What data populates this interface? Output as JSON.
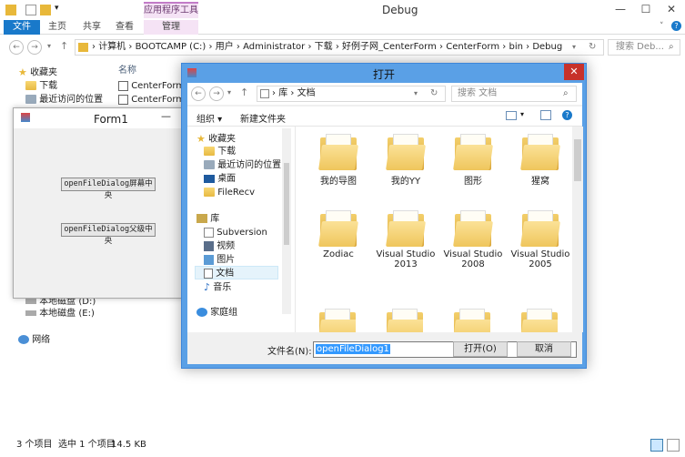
{
  "explorer": {
    "title": "Debug",
    "context_tool_label": "应用程序工具",
    "tabs": [
      "文件",
      "主页",
      "共享",
      "查看",
      "管理"
    ],
    "breadcrumb": [
      "计算机",
      "BOOTCAMP (C:)",
      "用户",
      "Administrator",
      "下载",
      "好例子网_CenterForm",
      "CenterForm",
      "bin",
      "Debug"
    ],
    "search_placeholder": "搜索 Deb...",
    "nav": {
      "favorites": "收藏夹",
      "downloads": "下载",
      "recent": "最近访问的位置",
      "local_disk_d": "本地磁盘 (D:)",
      "local_disk_e": "本地磁盘 (E:)",
      "network": "网络"
    },
    "column_name": "名称",
    "files": [
      "CenterForm.e",
      "CenterForm.p"
    ],
    "status": {
      "count": "3 个项目",
      "selected": "选中 1 个项目",
      "size": "14.5 KB"
    }
  },
  "form1": {
    "title": "Form1",
    "btn_screen_center": "openFileDialog屏幕中央",
    "btn_parent_center": "openFileDialog父级中央"
  },
  "dialog": {
    "title": "打开",
    "breadcrumb": [
      "库",
      "文档"
    ],
    "search_placeholder": "搜索 文档",
    "organize": "组织 ▾",
    "new_folder": "新建文件夹",
    "nav": {
      "favorites": "收藏夹",
      "downloads": "下载",
      "recent": "最近访问的位置",
      "desktop": "桌面",
      "filerecv": "FileRecv",
      "libraries": "库",
      "subversion": "Subversion",
      "videos": "视频",
      "pictures": "图片",
      "documents": "文档",
      "music": "音乐",
      "homegroup": "家庭组"
    },
    "folders": [
      {
        "name": "我的导图"
      },
      {
        "name": "我的YY"
      },
      {
        "name": "图形"
      },
      {
        "name": "猩窝"
      },
      {
        "name": "Zodiac"
      },
      {
        "name": "Visual Studio 2013"
      },
      {
        "name": "Visual Studio 2008"
      },
      {
        "name": "Visual Studio 2005"
      }
    ],
    "filename_label": "文件名(N):",
    "filename_value": "openFileDialog1",
    "open_button": "打开(O)",
    "cancel_button": "取消"
  }
}
